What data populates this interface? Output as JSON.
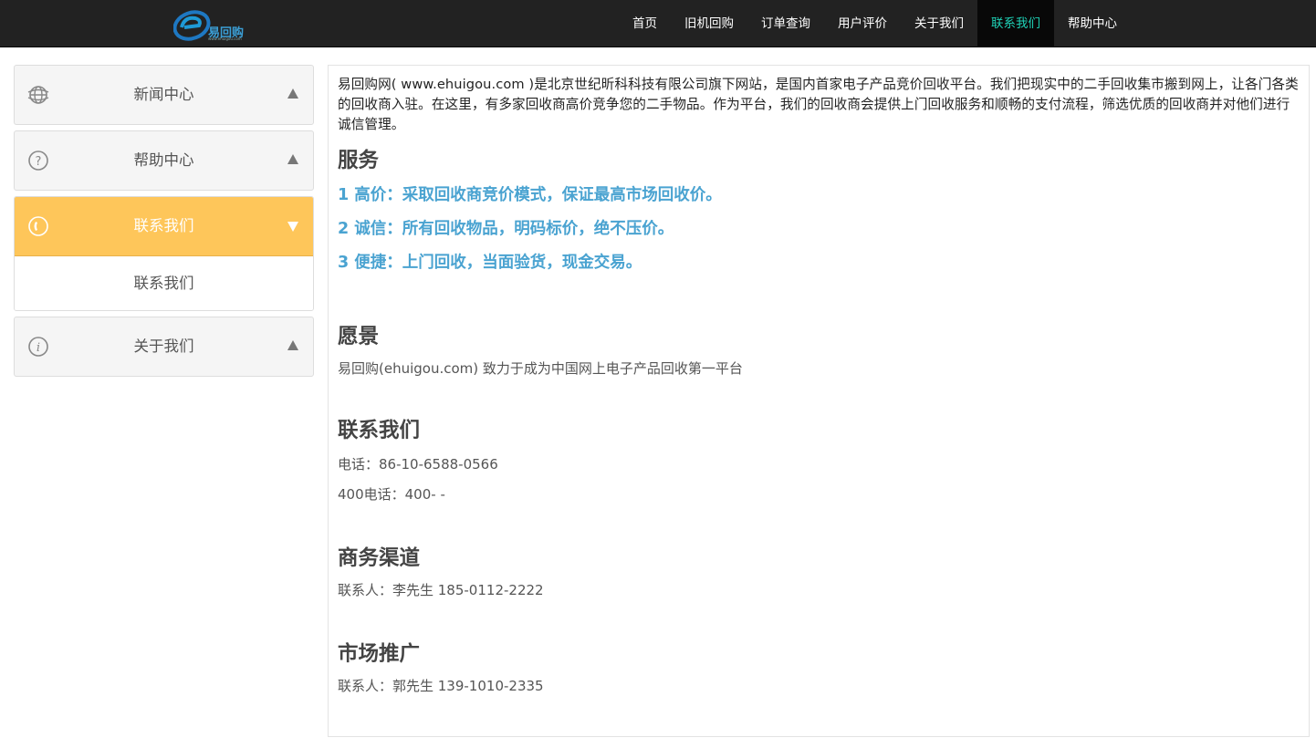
{
  "brand": {
    "logo_text": "易回购",
    "logo_sub": "www.ehuigou.com",
    "accent_color": "#1fd1b6",
    "logo_color": "#3b9fd6"
  },
  "nav": {
    "items": [
      {
        "label": "首页"
      },
      {
        "label": "旧机回购"
      },
      {
        "label": "订单查询"
      },
      {
        "label": "用户评价"
      },
      {
        "label": "关于我们"
      },
      {
        "label": "联系我们",
        "active": true
      },
      {
        "label": "帮助中心"
      }
    ]
  },
  "sidebar": {
    "panels": [
      {
        "icon": "globe-icon",
        "title": "新闻中心",
        "open": false
      },
      {
        "icon": "question-circle-icon",
        "title": "帮助中心",
        "open": false
      },
      {
        "icon": "phone-icon",
        "title": "联系我们",
        "open": true,
        "items": [
          {
            "label": "联系我们"
          }
        ]
      },
      {
        "icon": "info-circle-icon",
        "title": "关于我们",
        "open": false
      }
    ],
    "open_color": "#fec65a"
  },
  "content": {
    "intro": "易回购网( www.ehuigou.com )是北京世纪昕科科技有限公司旗下网站，是国内首家电子产品竞价回收平台。我们把现实中的二手回收集市搬到网上，让各门各类的回收商入驻。在这里，有多家回收商高价竞争您的二手物品。作为平台，我们的回收商会提供上门回收服务和顺畅的支付流程，筛选优质的回收商并对他们进行诚信管理。",
    "services_heading": "服务",
    "services": [
      "1 高价：采取回收商竞价模式，保证最高市场回收价。",
      "2 诚信：所有回收物品，明码标价，绝不压价。",
      "3 便捷：上门回收，当面验货，现金交易。"
    ],
    "vision_heading": "愿景",
    "vision_text": "易回购(ehuigou.com) 致力于成为中国网上电子产品回收第一平台",
    "contact_heading": "联系我们",
    "phone": "电话：86-10-6588-0566",
    "phone400": "400电话：400- -",
    "business_heading": "商务渠道",
    "business_contact": "联系人：李先生 185-0112-2222",
    "marketing_heading": "市场推广",
    "marketing_contact": "联系人：郭先生 139-1010-2335"
  }
}
